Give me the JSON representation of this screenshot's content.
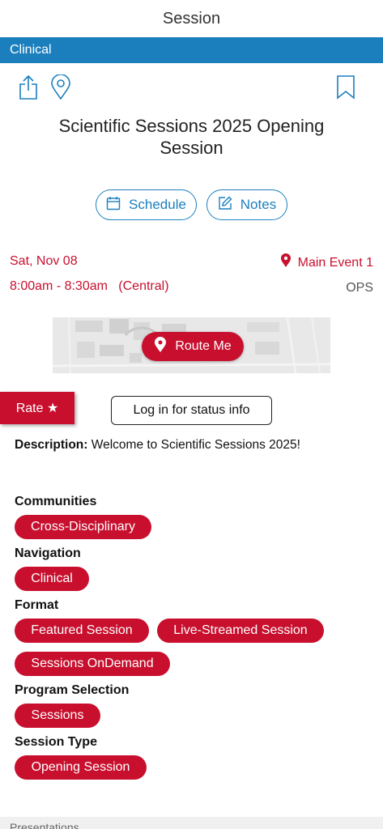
{
  "header": {
    "title": "Session"
  },
  "category_bar": {
    "label": "Clinical"
  },
  "session": {
    "title": "Scientific Sessions 2025 Opening Session",
    "date": "Sat, Nov 08",
    "time": "8:00am - 8:30am   (Central)",
    "location": "Main Event 1",
    "room_code": "OPS"
  },
  "actions": {
    "schedule_label": "Schedule",
    "notes_label": "Notes",
    "route_label": "Route Me",
    "rate_label": "Rate ★",
    "login_label": "Log in for status info"
  },
  "description": {
    "label": "Description:",
    "text": " Welcome to Scientific Sessions 2025!"
  },
  "groups": {
    "communities": {
      "label": "Communities",
      "tags": [
        "Cross-Disciplinary"
      ]
    },
    "navigation": {
      "label": "Navigation",
      "tags": [
        "Clinical"
      ]
    },
    "format": {
      "label": "Format",
      "tags": [
        "Featured Session",
        "Live-Streamed Session",
        "Sessions OnDemand"
      ]
    },
    "program_selection": {
      "label": "Program Selection",
      "tags": [
        "Sessions"
      ]
    },
    "session_type": {
      "label": "Session Type",
      "tags": [
        "Opening Session"
      ]
    }
  },
  "bottom": {
    "label": "Presentations"
  },
  "icons": {
    "share": "share-icon",
    "location": "location-pin-icon",
    "bookmark": "bookmark-icon",
    "calendar": "calendar-icon",
    "notes": "edit-icon"
  },
  "colors": {
    "primary_blue": "#1b7fbe",
    "accent_red": "#c8102e"
  }
}
